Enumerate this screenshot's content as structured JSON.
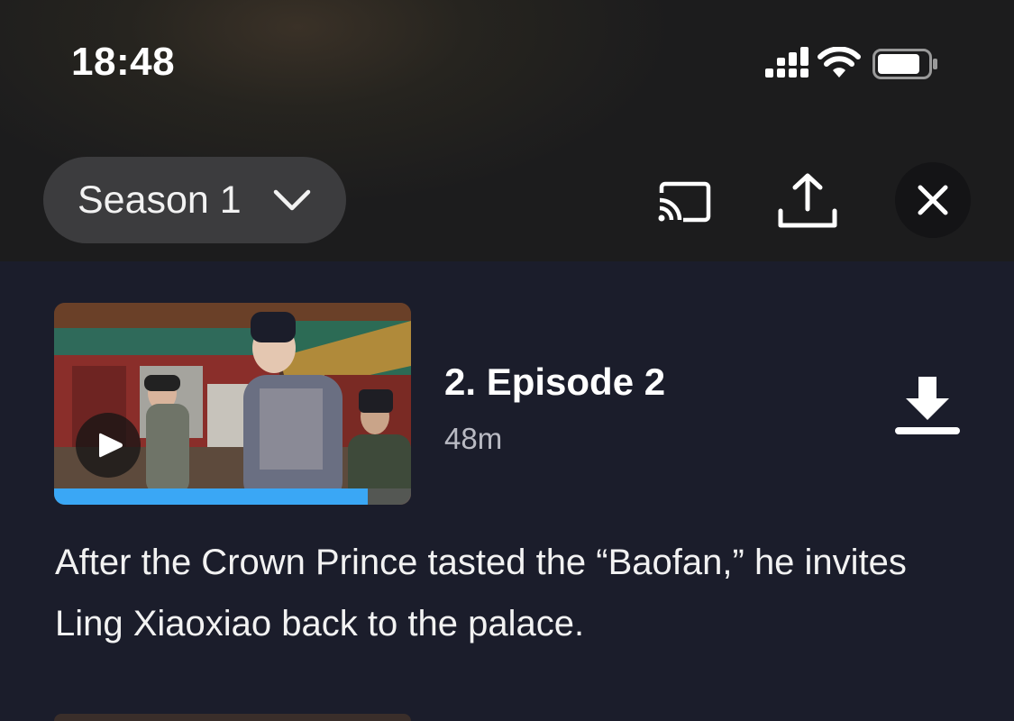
{
  "status_bar": {
    "time": "18:48",
    "icons": [
      "signal-icon",
      "wifi-icon",
      "battery-icon"
    ]
  },
  "toolbar": {
    "season_label": "Season 1",
    "icons": [
      "chevron-down-icon",
      "cast-icon",
      "share-icon",
      "close-icon"
    ]
  },
  "episode": {
    "title": "2. Episode 2",
    "duration": "48m",
    "description": "After the Crown Prince tasted the “Baofan,” he invites Ling Xiaoxiao back to the palace.",
    "watch_progress": 0.88,
    "icons": [
      "play-icon",
      "download-icon"
    ]
  },
  "colors": {
    "background": "#1b1d2b",
    "progress_accent": "#3aa7f5",
    "pill_background": "#3c3c3e"
  }
}
